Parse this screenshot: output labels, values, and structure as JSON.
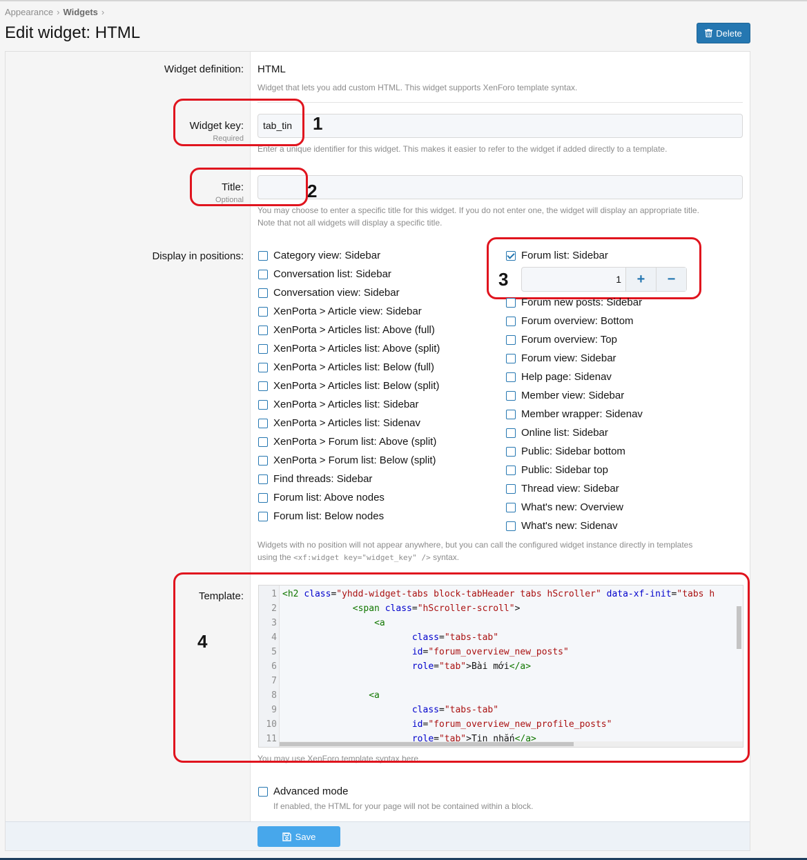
{
  "breadcrumb": {
    "item1": "Appearance",
    "item2": "Widgets",
    "sep": "›"
  },
  "page_title": "Edit widget: HTML",
  "header": {
    "delete_label": "Delete"
  },
  "widget_definition": {
    "label": "Widget definition:",
    "value": "HTML",
    "description": "Widget that lets you add custom HTML. This widget supports XenForo template syntax."
  },
  "widget_key": {
    "label": "Widget key:",
    "hint": "Required",
    "value": "tab_tin",
    "explain": "Enter a unique identifier for this widget. This makes it easier to refer to the widget if added directly to a template."
  },
  "title_field": {
    "label": "Title:",
    "hint": "Optional",
    "value": "",
    "explain_line1": "You may choose to enter a specific title for this widget. If you do not enter one, the widget will display an appropriate title.",
    "explain_line2": "Note that not all widgets will display a specific title."
  },
  "positions": {
    "label": "Display in positions:",
    "left": [
      "Category view: Sidebar",
      "Conversation list: Sidebar",
      "Conversation view: Sidebar",
      "XenPorta > Article view: Sidebar",
      "XenPorta > Articles list: Above (full)",
      "XenPorta > Articles list: Above (split)",
      "XenPorta > Articles list: Below (full)",
      "XenPorta > Articles list: Below (split)",
      "XenPorta > Articles list: Sidebar",
      "XenPorta > Articles list: Sidenav",
      "XenPorta > Forum list: Above (split)",
      "XenPorta > Forum list: Below (split)",
      "Find threads: Sidebar",
      "Forum list: Above nodes",
      "Forum list: Below nodes"
    ],
    "right_checked": "Forum list: Sidebar",
    "order_value": "1",
    "right": [
      "Forum new posts: Sidebar",
      "Forum overview: Bottom",
      "Forum overview: Top",
      "Forum view: Sidebar",
      "Help page: Sidenav",
      "Member view: Sidebar",
      "Member wrapper: Sidenav",
      "Online list: Sidebar",
      "Public: Sidebar bottom",
      "Public: Sidebar top",
      "Thread view: Sidebar",
      "What's new: Overview",
      "What's new: Sidenav"
    ],
    "explain_line1": "Widgets with no position will not appear anywhere, but you can call the configured widget instance directly in templates",
    "explain_line2_pre": "using the",
    "explain_line2_code": "<xf:widget key=\"widget_key\" />",
    "explain_line2_post": "syntax."
  },
  "template": {
    "label": "Template:",
    "explain": "You may use XenForo template syntax here.",
    "line_numbers": [
      "1",
      "2",
      "3",
      "4",
      "5",
      "6",
      "7",
      "8",
      "9",
      "10",
      "11"
    ],
    "code": {
      "l1_tag": "<h2",
      "l1_attr1": "class",
      "l1_str1": "\"yhdd-widget-tabs block-tabHeader tabs hScroller\"",
      "l1_attr2": "data-xf-init",
      "l1_str2": "\"tabs h",
      "l2_tag": "<span",
      "l2_attr": "class",
      "l2_str": "\"hScroller-scroll\"",
      "l3_tag": "<a",
      "l4_attr": "class",
      "l4_str": "\"tabs-tab\"",
      "l5_attr": "id",
      "l5_str": "\"forum_overview_new_posts\"",
      "l6_attr": "role",
      "l6_str": "\"tab\"",
      "l6_text": ">Bài mới",
      "l6_close": "</a>",
      "l8_tag": "<a",
      "l9_attr": "class",
      "l9_str": "\"tabs-tab\"",
      "l10_attr": "id",
      "l10_str": "\"forum_overview_new_profile_posts\"",
      "l11_attr": "role",
      "l11_str": "\"tab\"",
      "l11_text": ">Tin nhắn",
      "l11_close": "</a>"
    }
  },
  "advanced": {
    "label": "Advanced mode",
    "explain": "If enabled, the HTML for your page will not be contained within a block."
  },
  "footer": {
    "save_label": "Save"
  },
  "annotations": {
    "n1": "1",
    "n2": "2",
    "n3": "3",
    "n4": "4"
  },
  "icons": {
    "delete": "trash-icon",
    "save": "floppy-disk-icon",
    "checkbox": "checkbox-icon"
  },
  "colors": {
    "accent": "#2577b1",
    "annotation": "#e0141e",
    "save_button": "#47a7eb"
  }
}
